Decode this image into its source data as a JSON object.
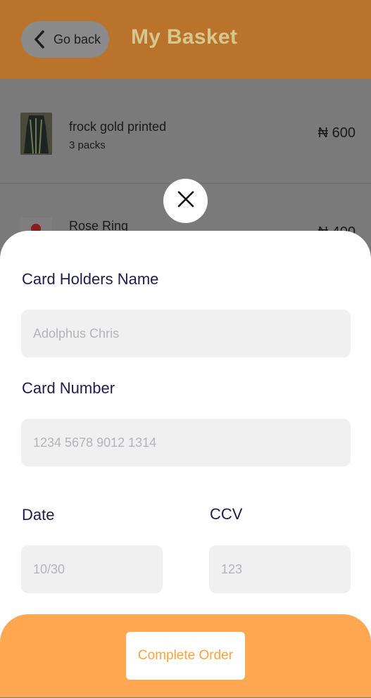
{
  "header": {
    "back_label": "Go back",
    "title": "My Basket"
  },
  "basket": {
    "items": [
      {
        "name": "frock gold printed",
        "qty": "3 packs",
        "price": "₦ 600"
      },
      {
        "name": "Rose Ring",
        "qty": "",
        "price": "₦ 400"
      }
    ]
  },
  "form": {
    "holder_label": "Card Holders Name",
    "holder_placeholder": "Adolphus Chris",
    "number_label": "Card Number",
    "number_placeholder": "1234 5678 9012 1314",
    "date_label": "Date",
    "date_placeholder": "10/30",
    "ccv_label": "CCV",
    "ccv_placeholder": "123"
  },
  "footer": {
    "complete_label": "Complete Order"
  },
  "colors": {
    "accent": "#ffa751",
    "label": "#1f1d4a",
    "field_bg": "#f1f0f1"
  }
}
